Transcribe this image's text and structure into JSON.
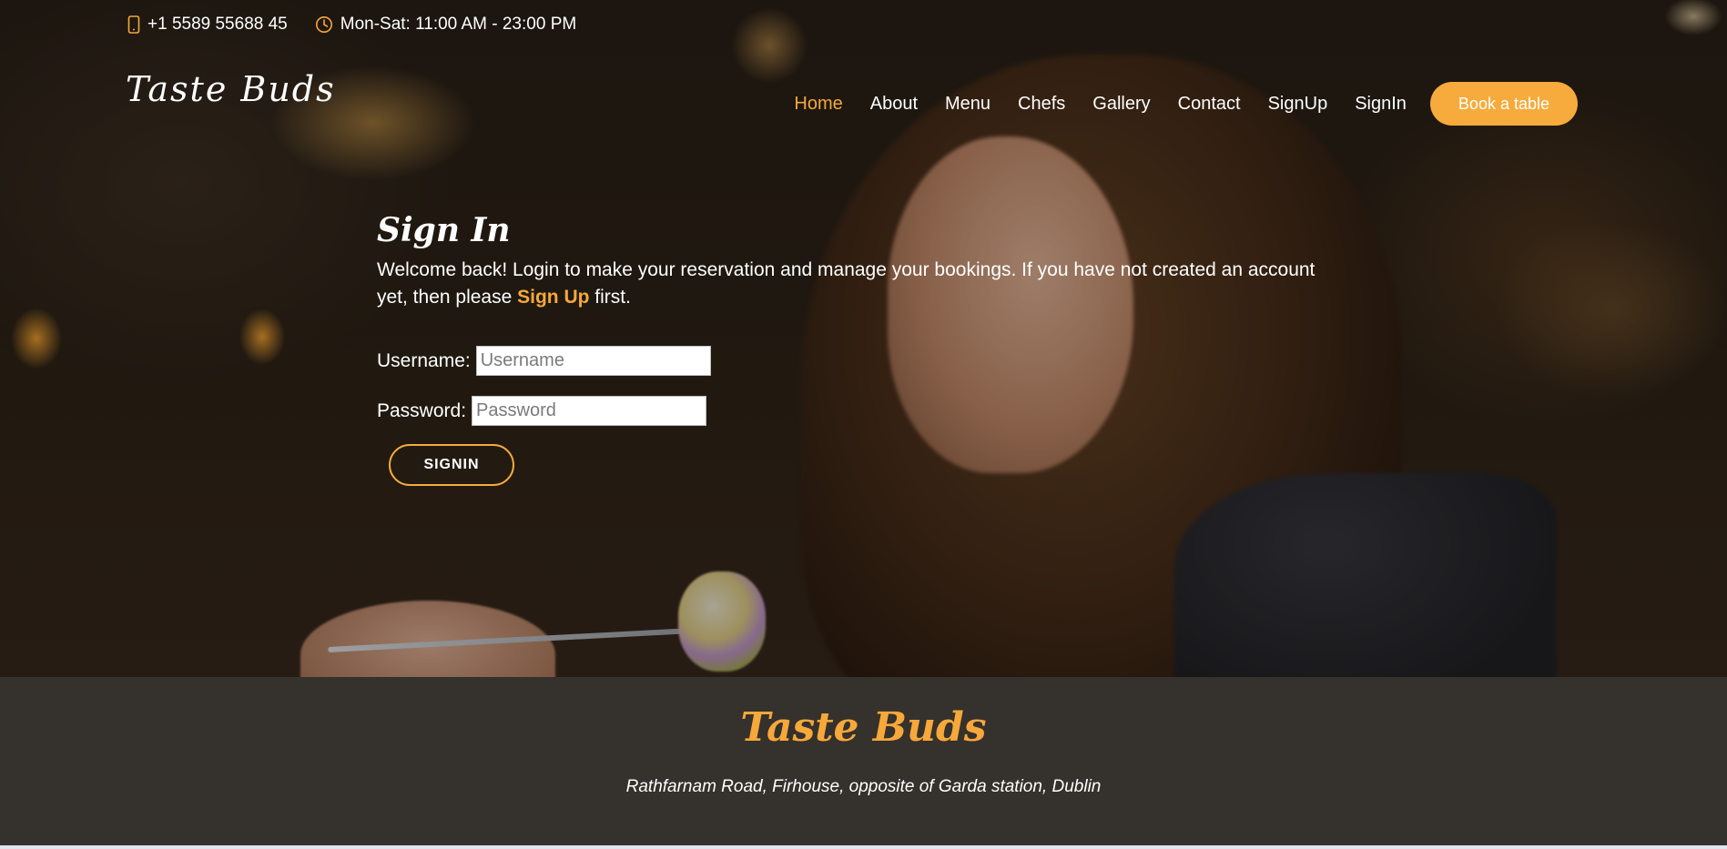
{
  "topbar": {
    "phone": "+1 5589 55688 45",
    "hours": "Mon-Sat: 11:00 AM - 23:00 PM"
  },
  "header": {
    "logo": "Taste Buds",
    "nav": [
      {
        "label": "Home",
        "active": true
      },
      {
        "label": "About"
      },
      {
        "label": "Menu"
      },
      {
        "label": "Chefs"
      },
      {
        "label": "Gallery"
      },
      {
        "label": "Contact"
      },
      {
        "label": "SignUp"
      },
      {
        "label": "SignIn"
      }
    ],
    "book_label": "Book a table"
  },
  "signin": {
    "title": "Sign In",
    "intro_before": "Welcome back! Login to make your reservation and manage your bookings. If you have not created an account yet, then please ",
    "signup_link": "Sign Up",
    "intro_after": " first.",
    "username_label": "Username:",
    "username_placeholder": "Username",
    "password_label": "Password:",
    "password_placeholder": "Password",
    "button_label": "SIGNIN"
  },
  "footer": {
    "title": "Taste Buds",
    "address": "Rathfarnam Road, Firhouse, opposite of Garda station, Dublin"
  },
  "colors": {
    "accent": "#f6a83a",
    "footer_bg": "#35312c"
  },
  "icons": {
    "phone": "phone-icon",
    "hours": "clock-icon"
  }
}
